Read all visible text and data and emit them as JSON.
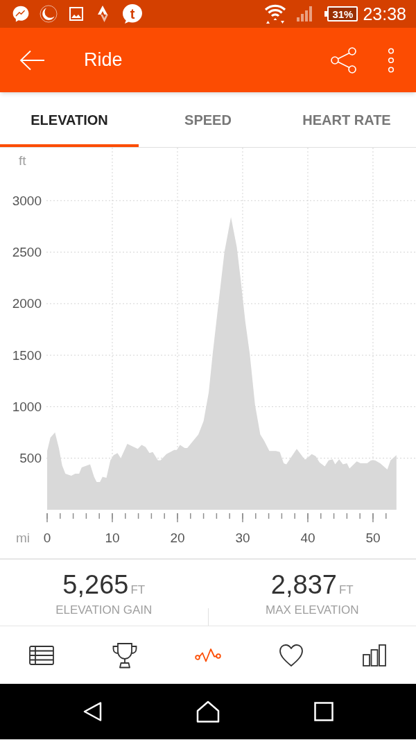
{
  "status_bar": {
    "notification_letter": "t",
    "battery": "31%",
    "time": "23:38"
  },
  "app_bar": {
    "title": "Ride"
  },
  "tabs": [
    {
      "label": "ELEVATION",
      "selected": true
    },
    {
      "label": "SPEED",
      "selected": false
    },
    {
      "label": "HEART RATE",
      "selected": false
    }
  ],
  "chart": {
    "chart_data": {
      "type": "area",
      "xlabel": "mi",
      "ylabel": "ft",
      "grid": true,
      "x": [
        0,
        0.5,
        1.2,
        1.8,
        2.3,
        2.8,
        3.7,
        4.3,
        4.9,
        5.3,
        6.6,
        7.2,
        7.6,
        8.1,
        8.5,
        9.1,
        9.7,
        10.2,
        10.8,
        11.3,
        12.3,
        13.9,
        14.5,
        15.1,
        15.7,
        16.2,
        17.0,
        17.4,
        18.3,
        19.5,
        19.9,
        20.4,
        21.1,
        21.5,
        23.2,
        24.0,
        24.8,
        25.4,
        26.3,
        27.2,
        28.2,
        29.1,
        29.7,
        30.4,
        31.1,
        31.9,
        32.7,
        33.3,
        34.1,
        35.1,
        35.7,
        36.3,
        36.7,
        38.3,
        39.5,
        39.7,
        40.6,
        41.2,
        41.8,
        42.6,
        43.2,
        43.8,
        44.2,
        44.8,
        45.4,
        46.0,
        46.4,
        47.5,
        48.1,
        49.1,
        49.7,
        50.3,
        51.1,
        52.2,
        52.7,
        53.6
      ],
      "values": [
        570,
        700,
        750,
        600,
        430,
        350,
        330,
        350,
        350,
        410,
        440,
        320,
        270,
        270,
        320,
        310,
        480,
        530,
        550,
        500,
        640,
        590,
        630,
        610,
        550,
        560,
        480,
        480,
        540,
        580,
        580,
        630,
        600,
        600,
        730,
        860,
        1140,
        1510,
        2010,
        2500,
        2840,
        2550,
        2230,
        1830,
        1510,
        1020,
        730,
        670,
        570,
        570,
        560,
        450,
        440,
        590,
        490,
        490,
        540,
        520,
        460,
        420,
        480,
        490,
        440,
        490,
        440,
        450,
        400,
        470,
        450,
        450,
        480,
        480,
        450,
        390,
        480,
        530
      ],
      "xlim": [
        0,
        56.6
      ],
      "ylim": [
        0,
        3500
      ],
      "xticks": [
        0,
        10,
        20,
        30,
        40,
        50
      ],
      "yticks": [
        500,
        1000,
        1500,
        2000,
        2500,
        3000
      ]
    }
  },
  "stats": [
    {
      "value": "5,265",
      "unit": "FT",
      "label": "ELEVATION GAIN"
    },
    {
      "value": "2,837",
      "unit": "FT",
      "label": "MAX ELEVATION"
    }
  ],
  "bottom_nav": [
    {
      "selected": false
    },
    {
      "selected": false
    },
    {
      "selected": true
    },
    {
      "selected": false
    },
    {
      "selected": false
    }
  ]
}
